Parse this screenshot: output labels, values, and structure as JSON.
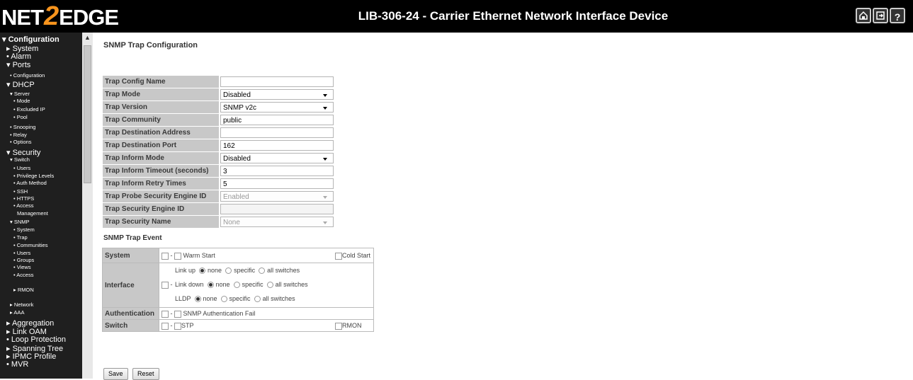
{
  "header": {
    "logo_left": "NET",
    "logo_mid": "2",
    "logo_right": "EDGE",
    "title": "LIB-306-24 - Carrier Ethernet Network Interface Device",
    "icons": [
      "home-icon",
      "logout-icon",
      "help-icon"
    ],
    "help_glyph": "?"
  },
  "sidebar": [
    {
      "label": "▾ Configuration",
      "level": 0
    },
    {
      "label": "▸ System",
      "level": 1
    },
    {
      "label": "• Alarm",
      "level": 1
    },
    {
      "label": "▾ Ports",
      "level": 1
    },
    {
      "label": "• Configuration",
      "level": 2
    },
    {
      "label": "▾ DHCP",
      "level": 1
    },
    {
      "label": "▾ Server",
      "level": 2
    },
    {
      "label": "• Mode",
      "level": 2
    },
    {
      "label": "• Excluded IP",
      "level": 2
    },
    {
      "label": "• Pool",
      "level": 2
    },
    {
      "label": "• Snooping",
      "level": 2
    },
    {
      "label": "• Relay",
      "level": 2
    },
    {
      "label": "• Options",
      "level": 2
    },
    {
      "label": "▾ Security",
      "level": 1
    },
    {
      "label": "▾ Switch",
      "level": 2
    },
    {
      "label": "• Users",
      "level": 2
    },
    {
      "label": "• Privilege Levels",
      "level": 2
    },
    {
      "label": "• Auth Method",
      "level": 2
    },
    {
      "label": "• SSH",
      "level": 2
    },
    {
      "label": "• HTTPS",
      "level": 2
    },
    {
      "label": "• Access",
      "level": 2
    },
    {
      "label": "Management",
      "level": 2
    },
    {
      "label": "▾ SNMP",
      "level": 2
    },
    {
      "label": "• System",
      "level": 2
    },
    {
      "label": "• Trap",
      "level": 2
    },
    {
      "label": "• Communities",
      "level": 2
    },
    {
      "label": "• Users",
      "level": 2
    },
    {
      "label": "• Groups",
      "level": 2
    },
    {
      "label": "• Views",
      "level": 2
    },
    {
      "label": "• Access",
      "level": 2
    },
    {
      "label": "▸ RMON",
      "level": 2
    },
    {
      "label": "▸ Network",
      "level": 2
    },
    {
      "label": "▸ AAA",
      "level": 2
    },
    {
      "label": "▸ Aggregation",
      "level": 1
    },
    {
      "label": "▸ Link OAM",
      "level": 1
    },
    {
      "label": "• Loop Protection",
      "level": 1
    },
    {
      "label": "▸ Spanning Tree",
      "level": 1
    },
    {
      "label": "▸ IPMC Profile",
      "level": 1
    },
    {
      "label": "• MVR",
      "level": 1
    }
  ],
  "page_title": "SNMP Trap Configuration",
  "config": [
    {
      "label": "Trap Config Name",
      "kind": "input",
      "value": "",
      "disabled": false
    },
    {
      "label": "Trap Mode",
      "kind": "select",
      "value": "Disabled",
      "disabled": false
    },
    {
      "label": "Trap Version",
      "kind": "select",
      "value": "SNMP v2c",
      "disabled": false
    },
    {
      "label": "Trap Community",
      "kind": "input",
      "value": "public",
      "disabled": false
    },
    {
      "label": "Trap Destination Address",
      "kind": "input",
      "value": "",
      "disabled": false
    },
    {
      "label": "Trap Destination Port",
      "kind": "input",
      "value": "162",
      "disabled": false
    },
    {
      "label": "Trap Inform Mode",
      "kind": "select",
      "value": "Disabled",
      "disabled": false
    },
    {
      "label": "Trap Inform Timeout (seconds)",
      "kind": "input",
      "value": "3",
      "disabled": false
    },
    {
      "label": "Trap Inform Retry Times",
      "kind": "input",
      "value": "5",
      "disabled": false
    },
    {
      "label": "Trap Probe Security Engine ID",
      "kind": "select",
      "value": "Enabled",
      "disabled": true
    },
    {
      "label": "Trap Security Engine ID",
      "kind": "input",
      "value": "",
      "disabled": true
    },
    {
      "label": "Trap Security Name",
      "kind": "select",
      "value": "None",
      "disabled": true
    }
  ],
  "event_title": "SNMP Trap Event",
  "events": {
    "system": {
      "label": "System",
      "warm": "Warm Start",
      "cold": "Cold Start"
    },
    "interface": {
      "label": "Interface",
      "rows": [
        {
          "name": "Link up",
          "selected": "none"
        },
        {
          "name": "Link down",
          "selected": "none"
        },
        {
          "name": "LLDP",
          "selected": "none"
        }
      ],
      "options": [
        "none",
        "specific",
        "all switches"
      ]
    },
    "authentication": {
      "label": "Authentication",
      "item": "SNMP Authentication Fail"
    },
    "switch": {
      "label": "Switch",
      "stp": "STP",
      "rmon": "RMON"
    },
    "dash": "-"
  },
  "buttons": {
    "save": "Save",
    "reset": "Reset"
  }
}
